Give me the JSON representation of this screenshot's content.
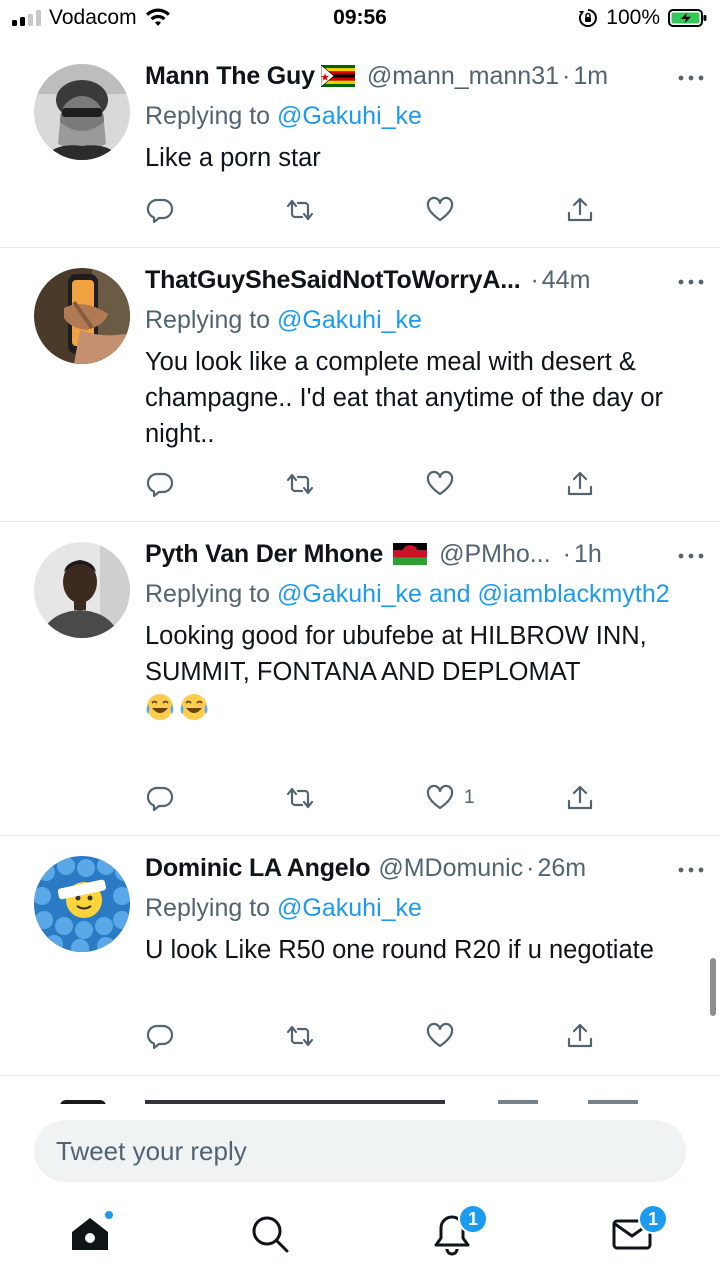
{
  "status_bar": {
    "carrier": "Vodacom",
    "time": "09:56",
    "battery_pct": "100%"
  },
  "tweets": [
    {
      "name": "Mann The Guy",
      "flag": "zimbabwe-flag",
      "handle": "@mann_mann31",
      "dot": "·",
      "time": "1m",
      "reply_prefix": "Replying to ",
      "mentions": "@Gakuhi_ke",
      "text": "Like a porn star",
      "like_count": ""
    },
    {
      "name": "ThatGuySheSaidNotToWorryA...",
      "flag": "",
      "handle": "",
      "dot": "·",
      "time": "44m",
      "reply_prefix": "Replying to ",
      "mentions": "@Gakuhi_ke",
      "text": "You look like a complete meal with desert & champagne.. I'd eat that anytime of the day or night..",
      "like_count": ""
    },
    {
      "name": "Pyth Van Der Mhone",
      "flag": "malawi-flag",
      "handle": "@PMho...",
      "dot": "·",
      "time": "1h",
      "reply_prefix": "Replying to ",
      "mentions": "@Gakuhi_ke and @iamblackmyth2",
      "text": "Looking good for ubufebe at HILBROW INN, SUMMIT, FONTANA AND DEPLOMAT",
      "emojis": [
        "tears-of-joy-emoji",
        "tears-of-joy-emoji"
      ],
      "like_count": "1"
    },
    {
      "name": "Dominic LA Angelo",
      "flag": "",
      "handle": "@MDomunic",
      "dot": "·",
      "time": "26m",
      "reply_prefix": "Replying to ",
      "mentions": "@Gakuhi_ke",
      "text": "U look Like R50 one round R20 if u negotiate",
      "like_count": ""
    }
  ],
  "reply_bar": {
    "placeholder": "Tweet your reply"
  },
  "tab_bar": {
    "notifications_badge": "1",
    "messages_badge": "1"
  },
  "colors": {
    "accent": "#1d9bf0",
    "secondary_text": "#536471",
    "primary_text": "#0f1419",
    "divider": "#e6e9ec"
  },
  "icons": {
    "reply": "reply-icon",
    "retweet": "retweet-icon",
    "like": "heart-icon",
    "share": "share-icon",
    "more": "more-icon"
  }
}
